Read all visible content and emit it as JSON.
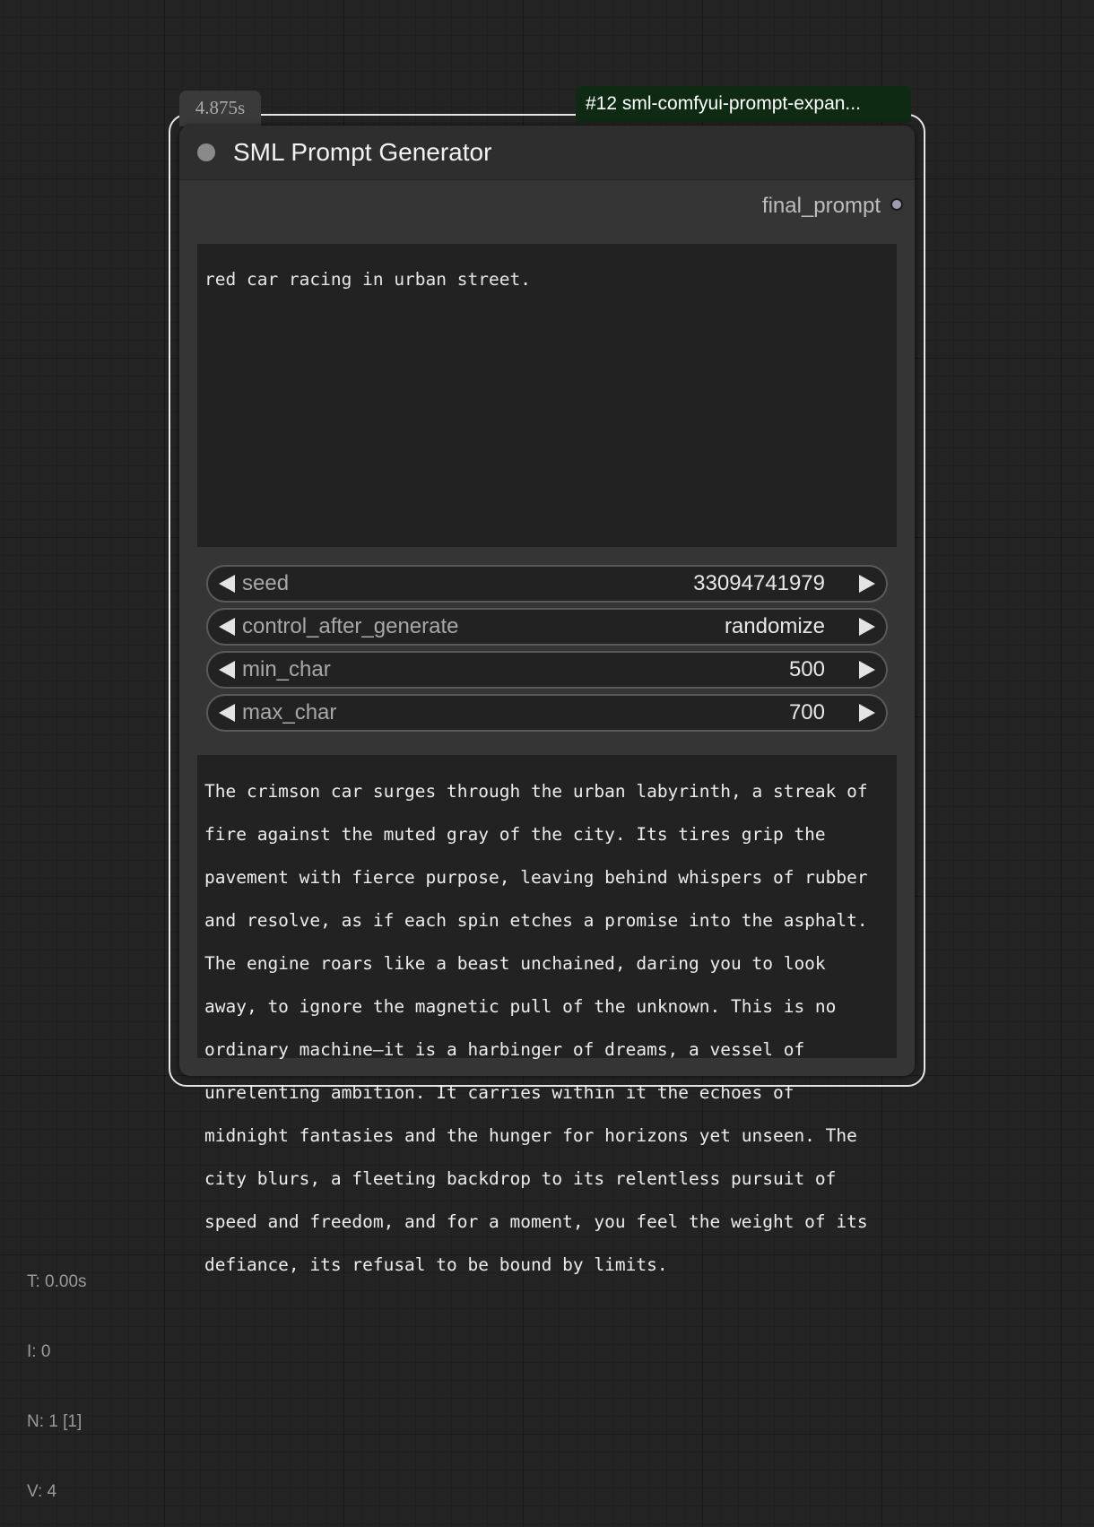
{
  "node": {
    "execution_time": "4.875s",
    "badge": "#12 sml-comfyui-prompt-expan...",
    "title": "SML Prompt Generator",
    "output_label": "final_prompt",
    "input_prompt": "red car racing in urban street.",
    "widgets": [
      {
        "label": "seed",
        "value": "33094741979"
      },
      {
        "label": "control_after_generate",
        "value": "randomize"
      },
      {
        "label": "min_char",
        "value": "500"
      },
      {
        "label": "max_char",
        "value": "700"
      }
    ],
    "result_lines": [
      "The crimson car surges through the urban labyrinth, a streak of",
      "fire against the muted gray of the city. Its tires grip the",
      "pavement with fierce purpose, leaving behind whispers of rubber",
      "and resolve, as if each spin etches a promise into the asphalt.",
      "The engine roars like a beast unchained, daring you to look",
      "away, to ignore the magnetic pull of the unknown. This is no",
      "ordinary machine—it is a harbinger of dreams, a vessel of",
      "unrelenting ambition. It carries within it the echoes of",
      "midnight fantasies and the hunger for horizons yet unseen. The",
      "city blurs, a fleeting backdrop to its relentless pursuit of",
      "speed and freedom, and for a moment, you feel the weight of its",
      "defiance, its refusal to be bound by limits."
    ]
  },
  "stats": {
    "t": "T: 0.00s",
    "i": "I: 0",
    "n": "N: 1 [1]",
    "v": "V: 4"
  }
}
